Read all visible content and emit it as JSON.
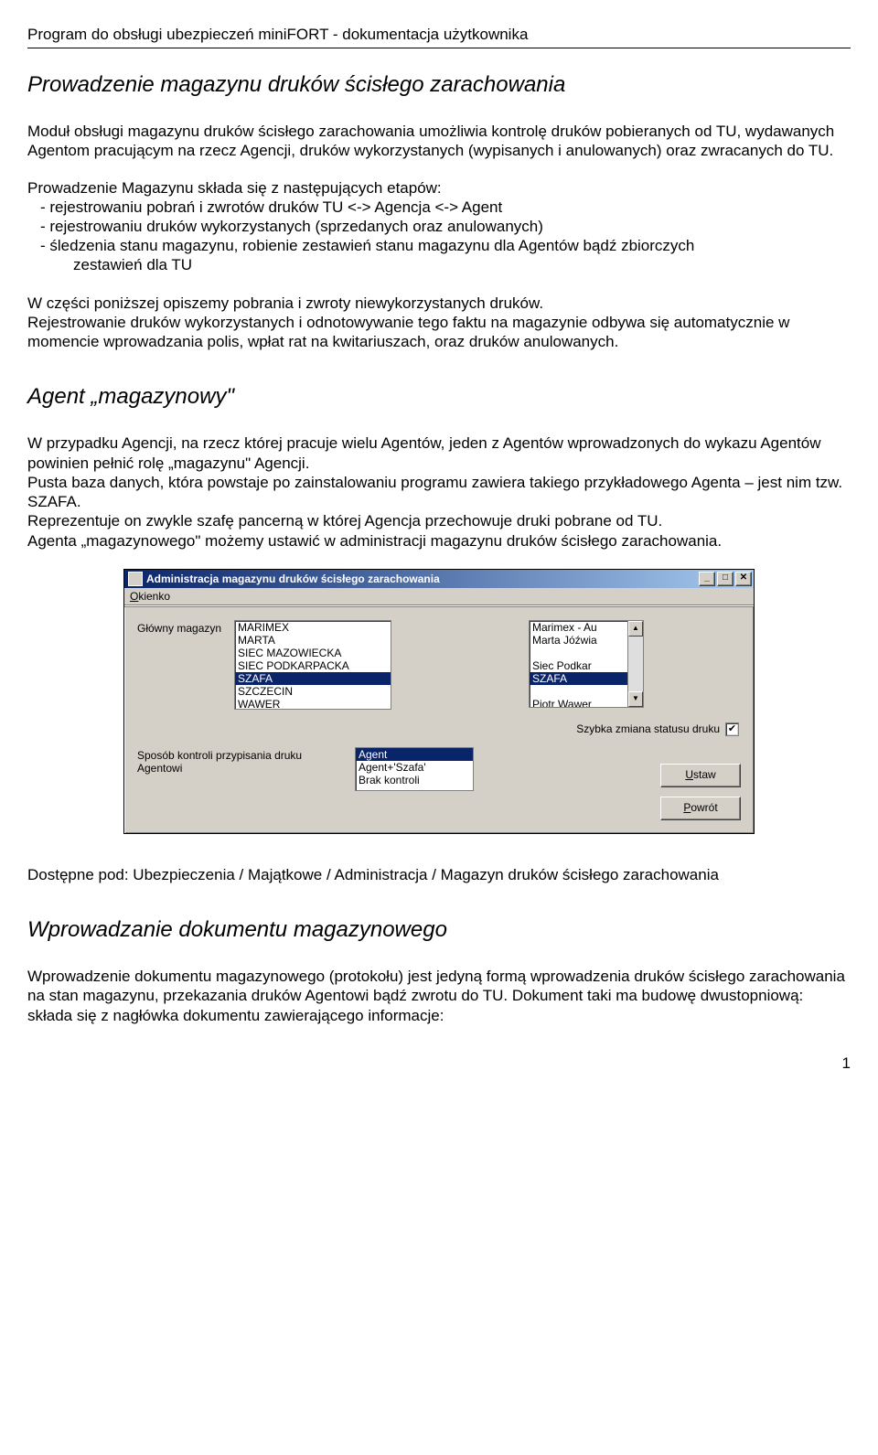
{
  "doc_header": "Program do obsługi ubezpieczeń miniFORT - dokumentacja użytkownika",
  "page_number": "1",
  "h1": "Prowadzenie magazynu druków ścisłego zarachowania",
  "p1": "Moduł obsługi magazynu druków ścisłego zarachowania umożliwia kontrolę druków pobieranych od TU, wydawanych Agentom pracującym na rzecz Agencji, druków wykorzystanych (wypisanych i anulowanych) oraz zwracanych do TU.",
  "list_intro": "Prowadzenie Magazynu składa się z następujących etapów:",
  "list": [
    "rejestrowaniu pobrań i zwrotów druków TU <-> Agencja <-> Agent",
    "rejestrowaniu druków wykorzystanych (sprzedanych oraz anulowanych)",
    "śledzenia stanu magazynu, robienie zestawień stanu magazynu dla Agentów bądź zbiorczych"
  ],
  "list_cont": "zestawień dla TU",
  "p2": "W części poniższej opiszemy pobrania i zwroty niewykorzystanych druków.\nRejestrowanie druków wykorzystanych i odnotowywanie tego faktu na magazynie odbywa się automatycznie w momencie wprowadzania polis, wpłat rat na kwitariuszach,  oraz druków anulowanych.",
  "h2a": "Agent „magazynowy\"",
  "p3": "W przypadku Agencji, na rzecz której pracuje wielu Agentów, jeden z Agentów wprowadzonych do wykazu Agentów powinien pełnić rolę „magazynu\" Agencji.\nPusta baza danych, która powstaje po zainstalowaniu programu zawiera takiego przykładowego Agenta – jest nim tzw. SZAFA.\nReprezentuje on zwykle szafę pancerną w której Agencja przechowuje druki pobrane od TU.\nAgenta „magazynowego\" możemy ustawić w administracji magazynu druków ścisłego zarachowania.",
  "p4": "Dostępne pod: Ubezpieczenia / Majątkowe / Administracja / Magazyn druków ścisłego zarachowania",
  "h2b": "Wprowadzanie dokumentu magazynowego",
  "p5": "Wprowadzenie dokumentu magazynowego (protokołu) jest jedyną formą wprowadzenia druków ścisłego zarachowania na stan magazynu, przekazania druków Agentowi bądź zwrotu do TU. Dokument taki ma budowę dwustopniową: składa się z nagłówka dokumentu zawierającego informacje:",
  "dialog": {
    "title": "Administracja magazynu druków ścisłego zarachowania",
    "menu_prefix": "O",
    "menu_rest": "kienko",
    "label_main": "Główny magazyn",
    "list1": [
      "MARIMEX",
      "MARTA",
      "SIEC MAZOWIECKA",
      "SIEC PODKARPACKA",
      "SZAFA",
      "SZCZECIN",
      "WAWER"
    ],
    "list2": [
      "Marimex - Au",
      "Marta Jóźwia",
      "",
      "Siec Podkar",
      "SZAFA",
      "",
      "Piotr Wawer"
    ],
    "chk_label": "Szybka zmiana statusu druku",
    "label_kontrola": "Sposób kontroli przypisania druku Agentowi",
    "list3": [
      "Agent",
      "Agent+'Szafa'",
      "Brak kontroli"
    ],
    "btn_ustaw_u": "U",
    "btn_ustaw_rest": "staw",
    "btn_powrot_u": "P",
    "btn_powrot_rest": "owrót",
    "winbtn_min": "_",
    "winbtn_max": "□",
    "winbtn_close": "✕",
    "scroll_up": "▲",
    "scroll_down": "▼",
    "checkmark": "✔"
  }
}
